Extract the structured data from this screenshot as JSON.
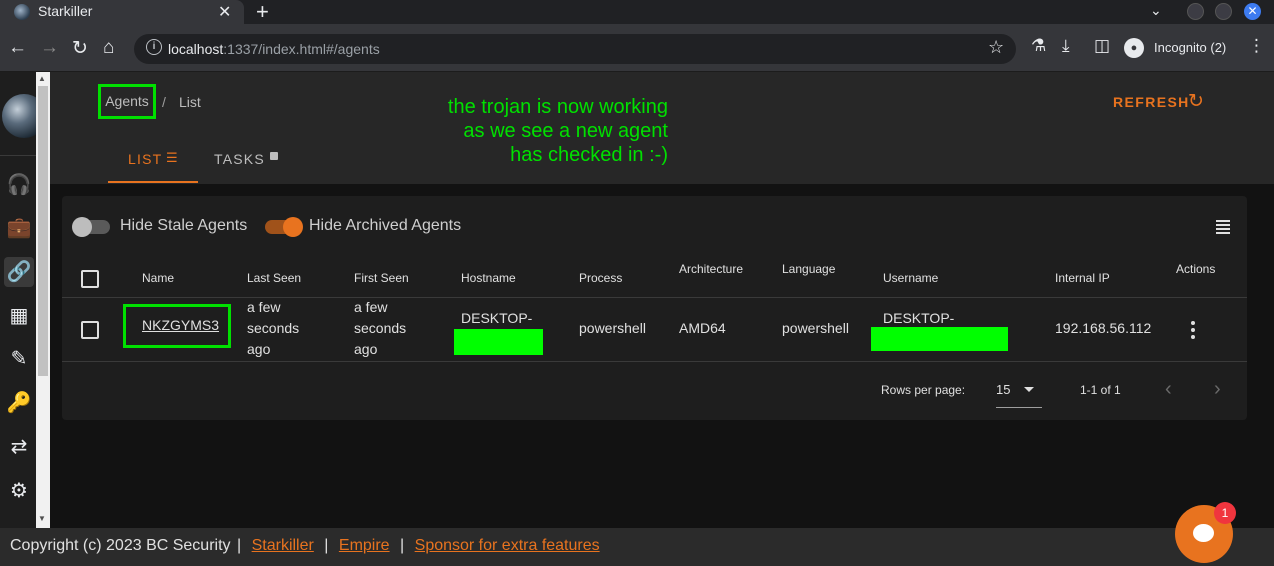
{
  "browser": {
    "tab_title": "Starkiller",
    "tab_close": "✕",
    "new_tab": "+",
    "url_host": "localhost",
    "url_rest": ":1337/index.html#/agents",
    "incognito_label": "Incognito (2)"
  },
  "header": {
    "breadcrumb": {
      "agents": "Agents",
      "separator": "/",
      "list": "List"
    },
    "annotation_lines": [
      "the trojan is now working",
      "as we see a new agent",
      "has checked in :-)"
    ],
    "refresh_label": "REFRESH",
    "tabs": [
      {
        "label": "LIST"
      },
      {
        "label": "TASKS"
      }
    ]
  },
  "filters": {
    "hide_stale": {
      "label": "Hide Stale Agents",
      "on": false
    },
    "hide_archived": {
      "label": "Hide Archived Agents",
      "on": true
    }
  },
  "table": {
    "columns": [
      "Name",
      "Last Seen",
      "First Seen",
      "Hostname",
      "Process",
      "Architecture",
      "Language",
      "Username",
      "Internal IP",
      "Actions"
    ],
    "rows": [
      {
        "name": "NKZGYMS3",
        "last_seen": [
          "a few",
          "seconds",
          "ago"
        ],
        "first_seen": [
          "a few",
          "seconds",
          "ago"
        ],
        "hostname": "DESKTOP-",
        "process": "powershell",
        "architecture": "AMD64",
        "language": "powershell",
        "username": "DESKTOP-",
        "internal_ip": "192.168.56.112"
      }
    ]
  },
  "pagination": {
    "rows_per_page_label": "Rows per page:",
    "rows_per_page_value": "15",
    "range": "1-1 of 1"
  },
  "footer": {
    "copyright": "Copyright (c) 2023 BC Security",
    "separator": "|",
    "links": [
      "Starkiller",
      "Empire",
      "Sponsor for extra features"
    ]
  },
  "chat": {
    "badge_count": "1"
  },
  "colors": {
    "accent": "#e8731f",
    "highlight": "#00e000",
    "redaction": "#00ff00"
  }
}
